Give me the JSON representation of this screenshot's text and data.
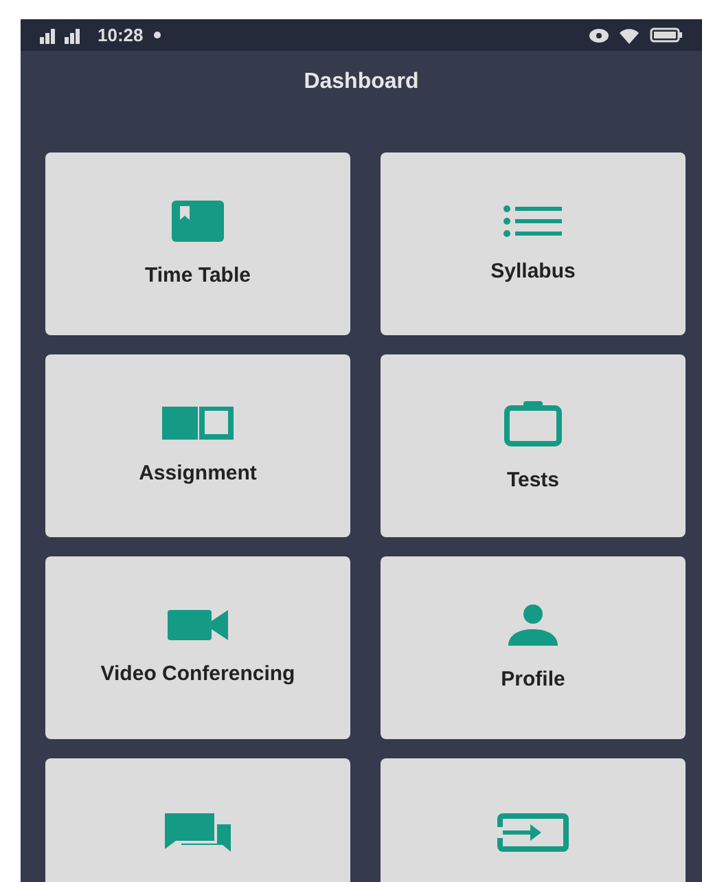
{
  "status_bar": {
    "time": "10:28"
  },
  "app_bar": {
    "title": "Dashboard"
  },
  "tiles": [
    {
      "kind": "timetable",
      "label": "Time Table"
    },
    {
      "kind": "syllabus",
      "label": "Syllabus"
    },
    {
      "kind": "assignment",
      "label": "Assignment"
    },
    {
      "kind": "tests",
      "label": "Tests"
    },
    {
      "kind": "video",
      "label": "Video Conferencing"
    },
    {
      "kind": "profile",
      "label": "Profile"
    },
    {
      "kind": "chat"
    },
    {
      "kind": "login"
    }
  ]
}
